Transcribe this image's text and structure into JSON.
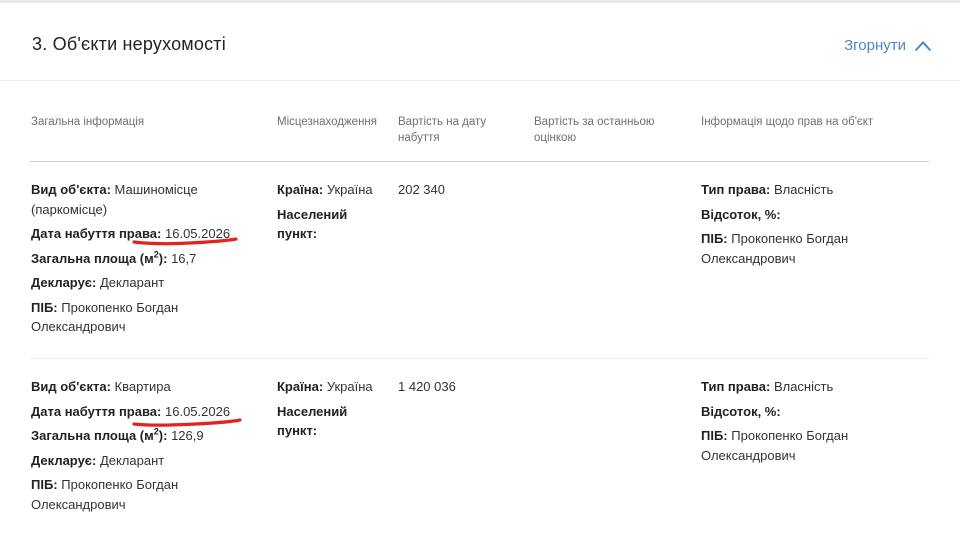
{
  "section": {
    "title": "3. Об'єкти нерухомості",
    "collapse_label": "Згорнути"
  },
  "columns": [
    "Загальна інформація",
    "Місцезнаходження",
    "Вартість на дату набуття",
    "Вартість за останньою оцінкою",
    "Інформація щодо прав на об'єкт"
  ],
  "labels": {
    "object_type": "Вид об'єкта:",
    "acquisition_date": "Дата набуття права:",
    "area_prefix": "Загальна площа (м",
    "area_sup": "2",
    "area_suffix": "):",
    "declarant": "Декларує:",
    "pib": "ПІБ:",
    "country": "Країна:",
    "settlement_line1": "Населений",
    "settlement_line2": "пункт:",
    "right_type": "Тип права:",
    "percent": "Відсоток, %:"
  },
  "rows": [
    {
      "object_type": "Машиномісце (паркомісце)",
      "acquisition_date": "16.05.2026",
      "area": "16,7",
      "declarant": "Декларант",
      "pib": "Прокопенко Богдан Олександрович",
      "country": "Україна",
      "settlement": "",
      "cost_acquisition": "202 340",
      "cost_last": "",
      "right_type": "Власність",
      "percent": "",
      "right_pib": "Прокопенко Богдан Олександрович"
    },
    {
      "object_type": "Квартира",
      "acquisition_date": "16.05.2026",
      "area": "126,9",
      "declarant": "Декларант",
      "pib": "Прокопенко Богдан Олександрович",
      "country": "Україна",
      "settlement": "",
      "cost_acquisition": "1 420 036",
      "cost_last": "",
      "right_type": "Власність",
      "percent": "",
      "right_pib": "Прокопенко Богдан Олександрович"
    }
  ],
  "colors": {
    "accent": "#4a87c9",
    "underline_mark": "#e3241b"
  }
}
